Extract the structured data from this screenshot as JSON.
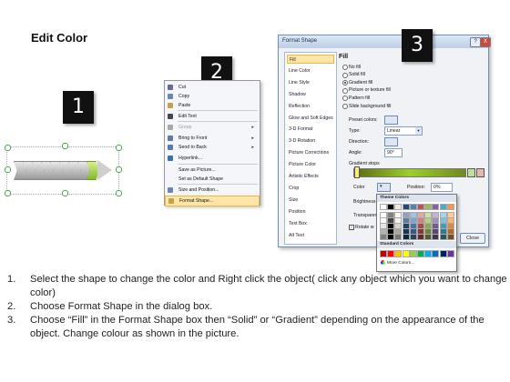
{
  "title": "Edit Color",
  "badges": [
    "1",
    "2",
    "3"
  ],
  "context_menu": {
    "items": [
      {
        "label": "Cut",
        "icon": "scissors-icon",
        "color": "#6a6a9a",
        "enabled": true,
        "submenu": false
      },
      {
        "label": "Copy",
        "icon": "copy-icon",
        "color": "#6b86b6",
        "enabled": true,
        "submenu": false
      },
      {
        "label": "Paste",
        "icon": "paste-icon",
        "color": "#c9a04a",
        "enabled": true,
        "submenu": false
      },
      {
        "label": "Edit Text",
        "icon": "text-icon",
        "color": "#445",
        "enabled": true,
        "submenu": false
      },
      {
        "label": "Group",
        "icon": "group-icon",
        "color": "#aaa",
        "enabled": false,
        "submenu": true
      },
      {
        "label": "Bring to Front",
        "icon": "bring-front-icon",
        "color": "#5a7ab0",
        "enabled": true,
        "submenu": true
      },
      {
        "label": "Send to Back",
        "icon": "send-back-icon",
        "color": "#5a7ab0",
        "enabled": true,
        "submenu": true
      },
      {
        "label": "Hyperlink...",
        "icon": "hyperlink-icon",
        "color": "#3a6fb0",
        "enabled": true,
        "submenu": false
      },
      {
        "label": "Save as Picture...",
        "icon": "",
        "color": "",
        "enabled": true,
        "submenu": false
      },
      {
        "label": "Set as Default Shape",
        "icon": "",
        "color": "",
        "enabled": true,
        "submenu": false
      },
      {
        "label": "Size and Position...",
        "icon": "size-position-icon",
        "color": "#6b86b6",
        "enabled": true,
        "submenu": false
      },
      {
        "label": "Format Shape...",
        "icon": "format-shape-icon",
        "color": "#c9a04a",
        "enabled": true,
        "submenu": false,
        "highlighted": true
      }
    ]
  },
  "dialog": {
    "title": "Format Shape",
    "help": "?",
    "close_x": "X",
    "categories": [
      "Fill",
      "Line Color",
      "Line Style",
      "Shadow",
      "Reflection",
      "Glow and Soft Edges",
      "3-D Format",
      "3-D Rotation",
      "Picture Corrections",
      "Picture Color",
      "Artistic Effects",
      "Crop",
      "Size",
      "Position",
      "Text Box",
      "Alt Text"
    ],
    "selected_category": "Fill",
    "section_title": "Fill",
    "fill_options": [
      "No fill",
      "Solid fill",
      "Gradient fill",
      "Picture or texture fill",
      "Pattern fill",
      "Slide background fill"
    ],
    "selected_fill": "Gradient fill",
    "preset_colors_label": "Preset colors:",
    "type_label": "Type:",
    "type_value": "Linear",
    "direction_label": "Direction:",
    "angle_label": "Angle:",
    "angle_value": "90°",
    "gradient_stops_label": "Gradient stops",
    "color_label": "Color",
    "position_label": "Position:",
    "position_value": "0%",
    "brightness_label": "Brightness",
    "transparency_label": "Transparen",
    "rotate_label": "Rotate w",
    "close_button": "Close",
    "palette": {
      "theme_heading": "Theme Colors",
      "standard_heading": "Standard Colors",
      "more_colors": "More Colors...",
      "theme_top": [
        "#ffffff",
        "#000000",
        "#eeece1",
        "#1f497d",
        "#4f81bd",
        "#c0504d",
        "#9bbb59",
        "#8064a2",
        "#4bacc6",
        "#f79646"
      ],
      "standard": [
        "#c00000",
        "#ff0000",
        "#ffc000",
        "#ffff00",
        "#92d050",
        "#00b050",
        "#00b0f0",
        "#0070c0",
        "#002060",
        "#7030a0"
      ]
    }
  },
  "instructions": [
    {
      "num": "1.",
      "text": "Select the shape to change the color and Right click the object( click any object which you want to change color)"
    },
    {
      "num": "2.",
      "text": "Choose Format Shape in the dialog box."
    },
    {
      "num": "3.",
      "text": "Choose “Fill” in the Format Shape box then “Solid” or “Gradient” depending on the appearance of the object. Change colour as shown in the picture."
    }
  ]
}
